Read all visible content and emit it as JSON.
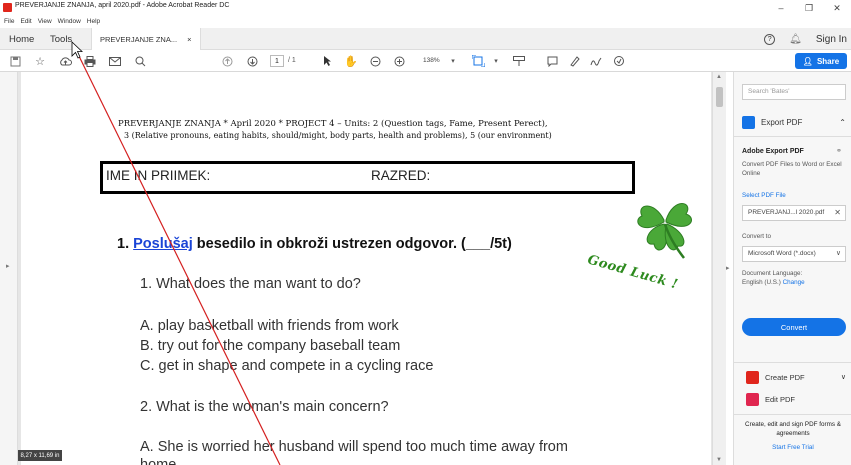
{
  "window": {
    "title": "PREVERJANJE ZNANJA, april 2020.pdf - Adobe Acrobat Reader DC",
    "minimize": "–",
    "maximize": "❐",
    "close": "✕"
  },
  "menu": [
    "File",
    "Edit",
    "View",
    "Window",
    "Help"
  ],
  "tabs": {
    "home": "Home",
    "tools": "Tools",
    "document": "PREVERJANJE ZNA...",
    "document_close": "×",
    "help": "?",
    "sign_in": "Sign In"
  },
  "toolbar": {
    "page_current": "1",
    "page_total": "/ 1",
    "zoom": "138%",
    "share": "Share"
  },
  "document": {
    "title_line1": "PREVERJANJE ZNANJA * April 2020 * PROJECT 4 – Units: 2 (Question tags, Fame, Present Perect),",
    "title_line2": "3 (Relative pronouns, eating habits, should/might, body parts, health and problems), 5 (our environment)",
    "name_label": "IME IN PRIIMEK:",
    "class_label": "RAZRED:",
    "task_number": "1.",
    "task_link": "Poslušaj",
    "task_text": "besedilo in obkroži ustrezen odgovor. (___/5t)",
    "lines": [
      "1. What does the man want to do?",
      "A. play basketball with friends from work",
      "B. try out for the company baseball team",
      "C. get in shape and compete in a cycling race",
      "2. What is the woman's main concern?",
      "A. She is worried her husband will spend too much time away from",
      "home."
    ],
    "good_luck": "Good Luck !"
  },
  "right_panel": {
    "search_placeholder": "Search 'Bates'",
    "export_pdf": "Export PDF",
    "adobe_export_title": "Adobe Export PDF",
    "adobe_export_desc": "Convert PDF Files to Word or Excel Online",
    "select_pdf": "Select PDF File",
    "file_name": "PREVERJANJ...l 2020.pdf",
    "convert_to": "Convert to",
    "format": "Microsoft Word (*.docx)",
    "doc_lang_label": "Document Language:",
    "doc_lang": "English (U.S.)",
    "change": "Change",
    "convert_button": "Convert",
    "create_pdf": "Create PDF",
    "edit_pdf": "Edit PDF",
    "promo": "Create, edit and sign PDF forms & agreements",
    "trial": "Start Free Trial"
  },
  "status": {
    "page_size": "8,27 x 11,69 in"
  },
  "colors": {
    "accent": "#1473e6",
    "acrobat_red": "#e0261c",
    "clover_green": "#2d8a1e"
  }
}
